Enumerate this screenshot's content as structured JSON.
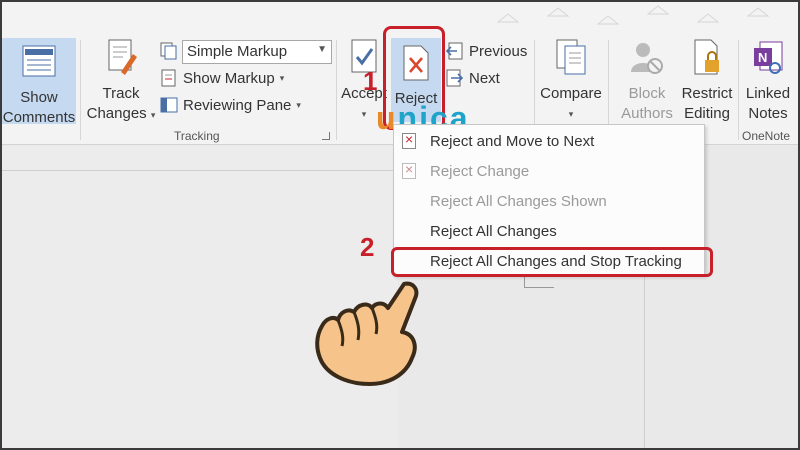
{
  "ribbon": {
    "show_comments": {
      "line1": "Show",
      "line2": "Comments"
    },
    "track_changes": {
      "line1": "Track",
      "line2": "Changes"
    },
    "markup_select": {
      "value": "Simple Markup"
    },
    "show_markup": "Show Markup",
    "reviewing_pane": "Reviewing Pane",
    "tracking_group": "Tracking",
    "accept": "Accept",
    "reject": "Reject",
    "previous": "Previous",
    "next": "Next",
    "compare": "Compare",
    "block_authors": {
      "line1": "Block",
      "line2": "Authors"
    },
    "restrict_editing": {
      "line1": "Restrict",
      "line2": "Editing"
    },
    "linked_notes": {
      "line1": "Linked",
      "line2": "Notes"
    },
    "onenote_group": "OneNote"
  },
  "menu": {
    "items": [
      {
        "label": "Reject and Move to Next",
        "disabled": false
      },
      {
        "label": "Reject Change",
        "disabled": true
      },
      {
        "label": "Reject All Changes Shown",
        "disabled": true
      },
      {
        "label": "Reject All Changes",
        "disabled": false
      },
      {
        "label": "Reject All Changes and Stop Tracking",
        "disabled": false
      }
    ]
  },
  "annotations": {
    "step1": "1",
    "step2": "2"
  },
  "logo": {
    "first": "u",
    "rest": "nica"
  },
  "colors": {
    "highlight": "#c8202a",
    "selected": "#c5d9f1",
    "logo_orange": "#e8892b",
    "logo_blue": "#1fa4c9"
  }
}
